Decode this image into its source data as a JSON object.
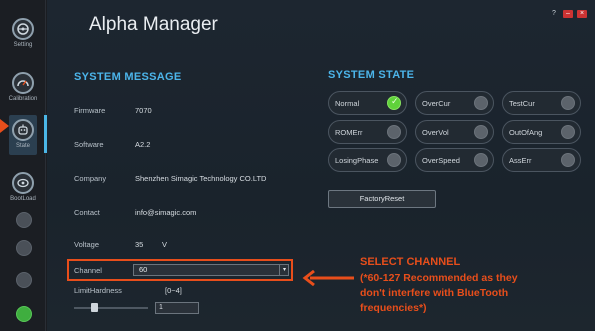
{
  "window": {
    "title": "Alpha Manager",
    "buttons": {
      "help": "?",
      "minimize": "–",
      "close": "×"
    }
  },
  "sidebar": {
    "items": [
      {
        "label": "Setting",
        "icon": "steering-wheel-icon"
      },
      {
        "label": "Calibration",
        "icon": "gauge-icon"
      },
      {
        "label": "State",
        "icon": "robot-icon",
        "active": true
      },
      {
        "label": "BootLoad",
        "icon": "boot-icon"
      }
    ],
    "extra_dots": 4,
    "accent_color": "#4bb6e6",
    "status_dot_color": "#3fae3f"
  },
  "system_message": {
    "title": "SYSTEM MESSAGE",
    "fields": [
      {
        "label": "Firmware",
        "value": "7070"
      },
      {
        "label": "Software",
        "value": "A2.2"
      },
      {
        "label": "Company",
        "value": "Shenzhen Simagic Technology CO.LTD"
      },
      {
        "label": "Contact",
        "value": "info@simagic.com"
      },
      {
        "label": "Voltage",
        "value": "35",
        "unit": "V"
      }
    ],
    "channel": {
      "label": "Channel",
      "value": "60",
      "dropdown_icon": "chevron-down-icon"
    },
    "limit_hardness": {
      "label": "LimitHardness",
      "range": "[0~4]",
      "value": "1",
      "slider_fraction": 0.25
    }
  },
  "system_state": {
    "title": "SYSTEM STATE",
    "items": [
      {
        "label": "Normal",
        "on": true
      },
      {
        "label": "OverCur",
        "on": false
      },
      {
        "label": "TestCur",
        "on": false
      },
      {
        "label": "ROMErr",
        "on": false
      },
      {
        "label": "OverVol",
        "on": false
      },
      {
        "label": "OutOfAng",
        "on": false
      },
      {
        "label": "LosingPhase",
        "on": false
      },
      {
        "label": "OverSpeed",
        "on": false
      },
      {
        "label": "AssErr",
        "on": false
      }
    ],
    "factory_reset_label": "FactoryReset",
    "led_on_color": "#5fd23a"
  },
  "annotation": {
    "title": "SELECT CHANNEL",
    "lines": [
      "(*60-127 Recommended as they",
      "don't interfere with BlueTooth",
      "frequencies*)"
    ],
    "color": "#e84e1b"
  }
}
